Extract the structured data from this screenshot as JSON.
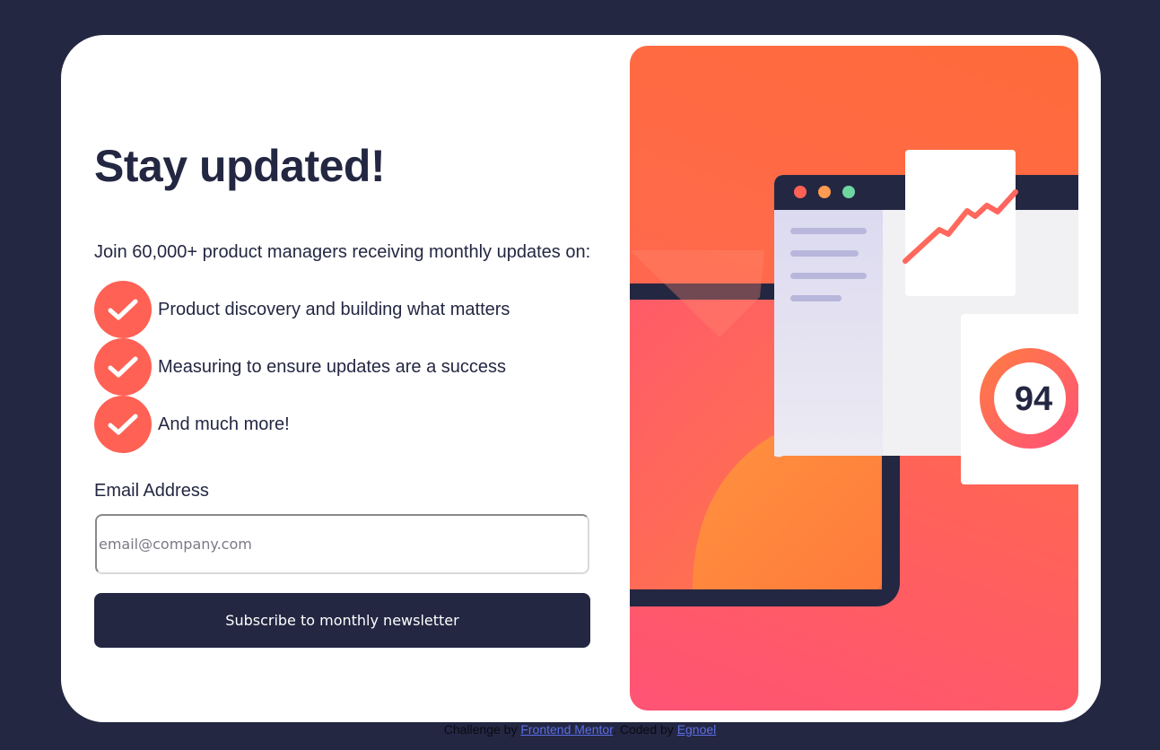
{
  "signup": {
    "title": "Stay updated!",
    "intro": "Join 60,000+ product managers receiving monthly updates on:",
    "features": [
      "Product discovery and building what matters",
      "Measuring to ensure updates are a success",
      "And much more!"
    ],
    "email_label": "Email Address",
    "email_placeholder": "email@company.com",
    "email_value": "",
    "subscribe_label": "Subscribe to monthly newsletter"
  },
  "illustration": {
    "score": "94"
  },
  "footer": {
    "prefix": "Challenge by",
    "challenge_link": "Frontend Mentor",
    "middle": ". Coded by",
    "author_link": "Egnoel"
  },
  "colors": {
    "background": "#242742",
    "card": "#ffffff",
    "accent": "#ff6155",
    "button": "#242742",
    "text": "#242742"
  },
  "icons": [
    "check-icon",
    "illustration-image"
  ]
}
